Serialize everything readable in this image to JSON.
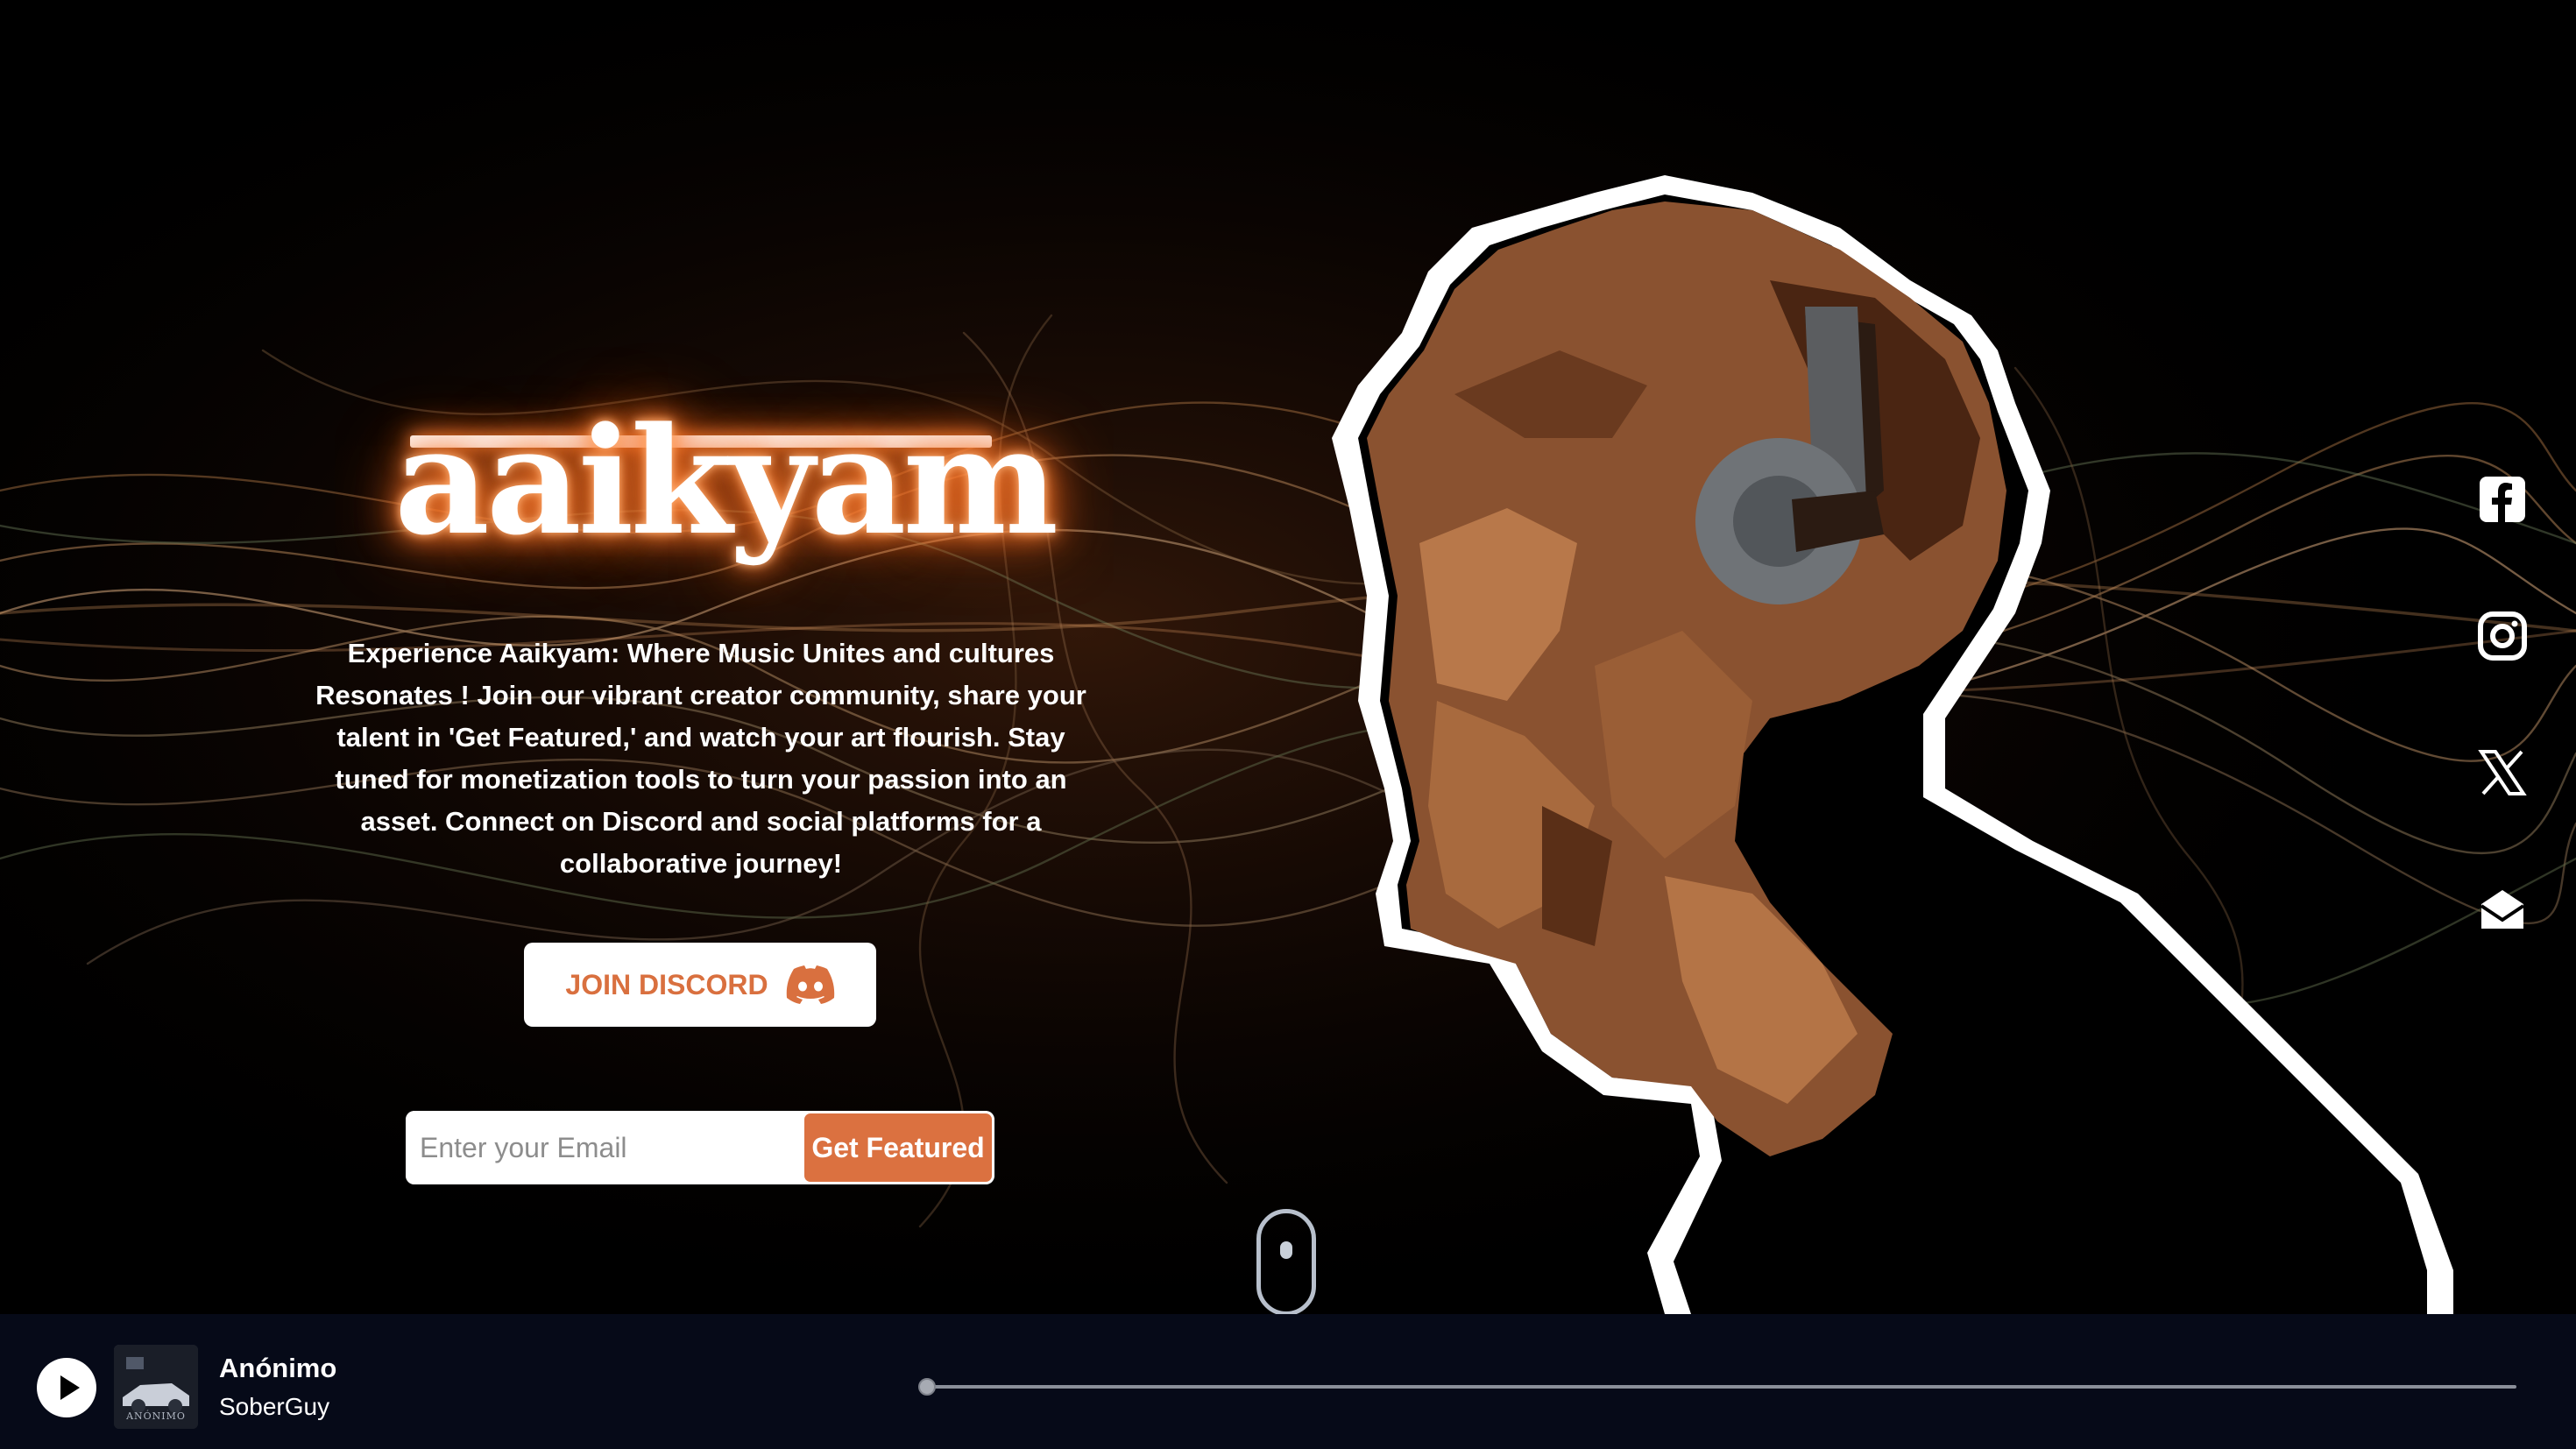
{
  "brand": {
    "logo_text": "aaikyam",
    "accent_color": "#db7140",
    "glow_color": "#ff7a2a"
  },
  "hero": {
    "description": "Experience Aaikyam: Where Music Unites and cultures Resonates ! Join our vibrant creator community, share your talent in 'Get Featured,' and watch your art flourish. Stay tuned for monetization tools to turn your passion into an asset. Connect on Discord and social platforms for a collaborative journey!",
    "discord_button_label": "JOIN DISCORD",
    "discord_icon": "discord-icon",
    "email_placeholder": "Enter your Email",
    "email_value": "",
    "featured_button_label": "Get Featured"
  },
  "socials": [
    {
      "name": "facebook",
      "icon": "facebook-icon"
    },
    {
      "name": "instagram",
      "icon": "instagram-icon"
    },
    {
      "name": "x",
      "icon": "x-icon"
    },
    {
      "name": "email",
      "icon": "mail-open-icon"
    }
  ],
  "player": {
    "track_title": "Anónimo",
    "artist": "SoberGuy",
    "cover_label": "ANÓNIMO",
    "state": "paused",
    "progress": 0.0
  }
}
